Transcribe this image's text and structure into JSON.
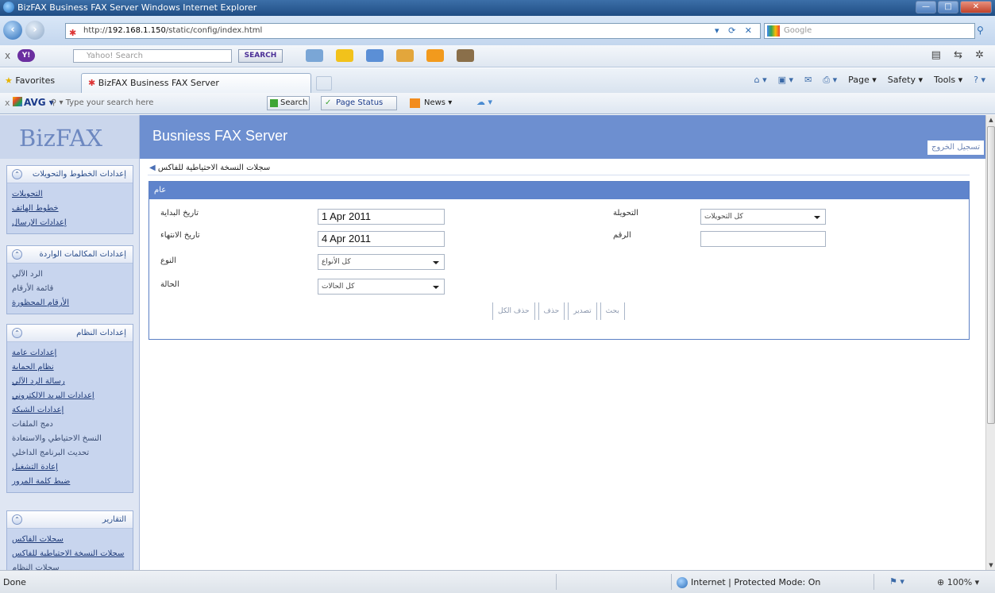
{
  "window": {
    "title": "BizFAX   Business FAX Server   Windows Internet Explorer",
    "buttons": [
      "—",
      "□",
      "✕"
    ]
  },
  "address": {
    "url_prefix": "http://",
    "url_host": "192.168.1.150",
    "url_path": "/static/config/index.html",
    "search_placeholder": "Google"
  },
  "yahoo": {
    "search_placeholder": "Yahoo! Search",
    "search_button": "SEARCH"
  },
  "favbar": {
    "favorites": "Favorites",
    "tab_title": "BizFAX   Business FAX Server",
    "commands": [
      "Page ▾",
      "Safety ▾",
      "Tools ▾"
    ]
  },
  "avg": {
    "logo": "AVG",
    "search_placeholder": "Type your search here",
    "search_button": "Search",
    "page_status": "Page Status",
    "news": "News"
  },
  "page": {
    "brand": "BizFAX",
    "app_title": "Busniess FAX Server",
    "logout": "تسجيل الخروج",
    "breadcrumb": "سجلات النسخة الاحتياطية للفاكس"
  },
  "sidebar": {
    "sections": [
      {
        "title": "إعدادات الخطوط والتحويلات",
        "toggle": "⌃",
        "links": [
          "التحويلات",
          "خطوط الهاتف",
          "إعدادات الإرسال"
        ]
      },
      {
        "title": "إعدادات المكالمات الواردة",
        "toggle": "⌃",
        "links": [
          "الرد الآلي",
          "قائمة الأرقام",
          "الأرقام المحظورة"
        ]
      },
      {
        "title": "إعدادات النظام",
        "toggle": "⌃",
        "links": [
          "إعدادات عامة",
          "نظام الحماية",
          "رسالة الرد الآلي",
          "إعدادات البريد الالكتروني",
          "إعدادات الشبكة",
          "دمج الملفات",
          "النسخ الاحتياطي والاستعادة",
          "تحديث البرنامج الداخلي",
          "إعادة التشغيل",
          "ضبط كلمة المرور"
        ]
      },
      {
        "title": "التقارير",
        "toggle": "⌃",
        "links": [
          "سجلات الفاكس",
          "سجلات النسخة الاحتياطية للفاكس",
          "سجلات النظام"
        ]
      }
    ]
  },
  "form": {
    "panel_title": "عام",
    "start_date_label": "تاريخ البداية",
    "start_date_value": "1 Apr 2011",
    "end_date_label": "تاريخ الانتهاء",
    "end_date_value": "4 Apr 2011",
    "type_label": "النوع",
    "type_value": "كل الأنواع",
    "status_label": "الحالة",
    "status_value": "كل الحالات",
    "routing_label": "التحويلة",
    "routing_value": "كل التحويلات",
    "number_label": "الرقم",
    "number_value": "",
    "actions": [
      "حذف الكل",
      "حذف",
      "تصدير",
      "بحث"
    ]
  },
  "status": {
    "text": "Done",
    "zone": "Internet | Protected Mode: On",
    "zoom": "100%"
  }
}
